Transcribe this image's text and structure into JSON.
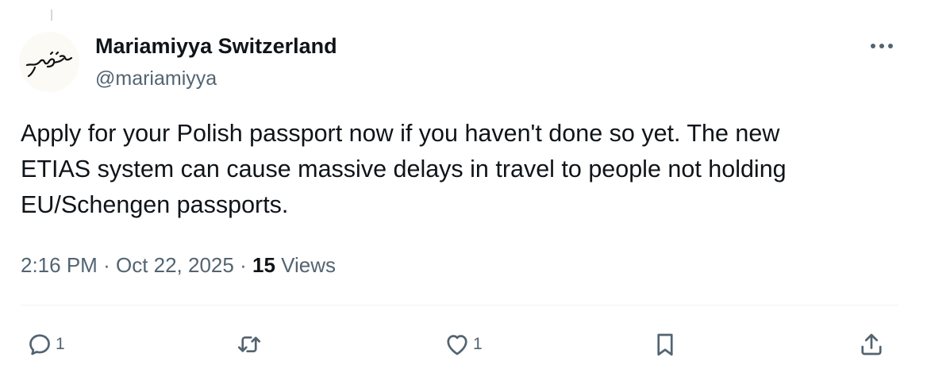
{
  "author": {
    "display_name": "Mariamiyya Switzerland",
    "handle": "@mariamiyya",
    "avatar_text": "مريم"
  },
  "tweet": {
    "text": "Apply for your Polish passport now if you haven't done so yet. The new\nETIAS system can cause massive delays in travel to people not holding\nEU/Schengen passports."
  },
  "meta": {
    "time": "2:16 PM",
    "separator": "·",
    "date": "Oct 22, 2025",
    "views_count": "15",
    "views_label": "Views"
  },
  "actions": {
    "reply_count": "1",
    "like_count": "1"
  },
  "icons": {
    "more": "more-icon",
    "reply": "reply-icon",
    "retweet": "retweet-icon",
    "like": "heart-icon",
    "bookmark": "bookmark-icon",
    "share": "share-icon"
  },
  "colors": {
    "text": "#0f1419",
    "secondary": "#536471",
    "divider": "#eff3f4"
  }
}
